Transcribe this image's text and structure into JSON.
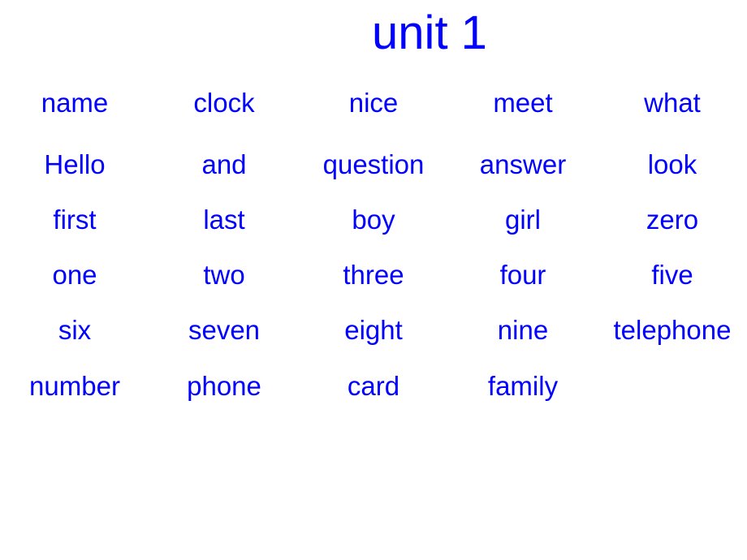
{
  "slide": {
    "title": "unit 1",
    "text_color": "#0000ff",
    "background": "#ffffff",
    "rows": [
      [
        "name",
        "clock",
        "nice",
        "meet",
        "what"
      ],
      [
        "Hello",
        "and",
        "question",
        "answer",
        "look"
      ],
      [
        "first",
        "last",
        "boy",
        "girl",
        "zero"
      ],
      [
        "one",
        "two",
        "three",
        "four",
        "five"
      ],
      [
        "six",
        "seven",
        "eight",
        "nine",
        "telephone"
      ],
      [
        "number",
        "phone",
        "card",
        "family",
        ""
      ]
    ]
  }
}
